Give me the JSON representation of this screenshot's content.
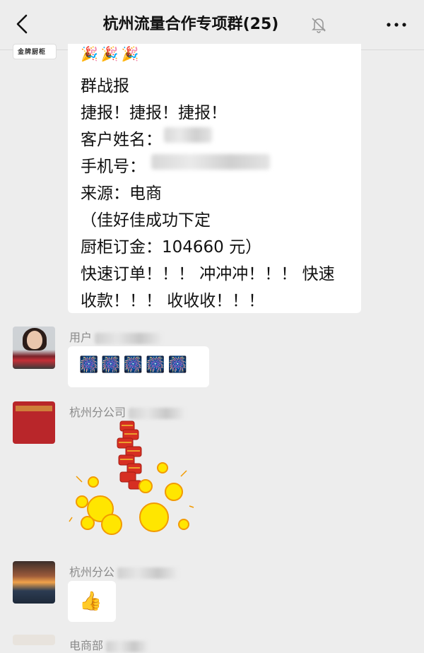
{
  "header": {
    "title": "杭州流量合作专项群(25)",
    "back_icon": "chevron-left-icon",
    "mute_icon": "bell-off-icon",
    "more_icon": "ellipsis-icon"
  },
  "messages": [
    {
      "avatar": {
        "icon": "company-logo-icon",
        "text": "金牌厨柜"
      },
      "lines": [
        "群战报",
        "捷报！捷报！捷报！",
        "客户姓名：",
        "手机号：",
        "来源：电商",
        "（佳好佳成功下定",
        "厨柜订金：104660 元）",
        "快速订单！！！ 冲冲冲！！！ 快速",
        "收款！！！ 收收收！！！"
      ],
      "emoji": "🎉🎉🎉"
    },
    {
      "sender": "用户",
      "content_icon": "fireworks-icon",
      "content": "🎆🎆🎆🎆🎆"
    },
    {
      "sender": "杭州分公司",
      "content_icon": "firecracker-sticker-icon"
    },
    {
      "sender": "杭州分公",
      "content_icon": "thumbs-up-icon",
      "content": "👍"
    },
    {
      "sender": "电商部"
    }
  ],
  "colors": {
    "background": "#ededed",
    "bubble": "#ffffff",
    "name": "#8a8a8a"
  }
}
